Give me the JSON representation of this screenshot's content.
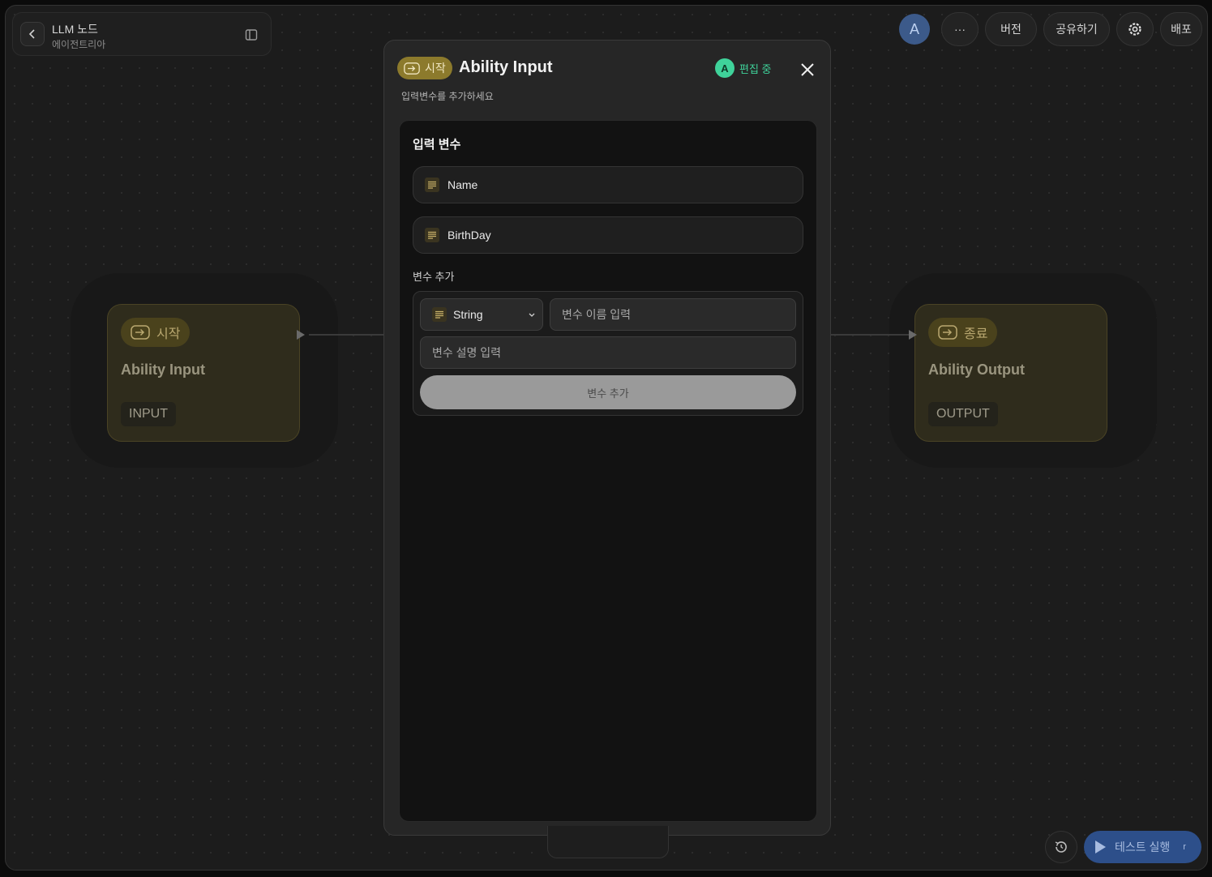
{
  "header": {
    "title": "LLM 노드",
    "subtitle": "에이전트리아"
  },
  "toolbar": {
    "avatar_initial": "A",
    "more_label": "···",
    "version_label": "버전",
    "share_label": "공유하기",
    "deploy_label": "배포"
  },
  "nodes": {
    "start": {
      "chip_label": "시작",
      "title": "Ability Input",
      "tag": "INPUT"
    },
    "end": {
      "chip_label": "종료",
      "title": "Ability Output",
      "tag": "OUTPUT"
    }
  },
  "modal": {
    "chip_label": "시작",
    "title": "Ability Input",
    "subtitle": "입력변수를 추가하세요",
    "editor_initial": "A",
    "editing_label": "편집 중",
    "section_title": "입력 변수",
    "variables": [
      {
        "name": "Name"
      },
      {
        "name": "BirthDay"
      }
    ],
    "add_section_label": "변수 추가",
    "type_select_value": "String",
    "name_placeholder": "변수 이름 입력",
    "desc_placeholder": "변수 설명 입력",
    "add_button_label": "변수 추가"
  },
  "footer": {
    "run_label": "테스트 실행",
    "run_shortcut": "r"
  },
  "colors": {
    "accent_gold": "#8c7a2c",
    "editing_green": "#3fd29a",
    "run_blue": "#2d4f8a"
  }
}
